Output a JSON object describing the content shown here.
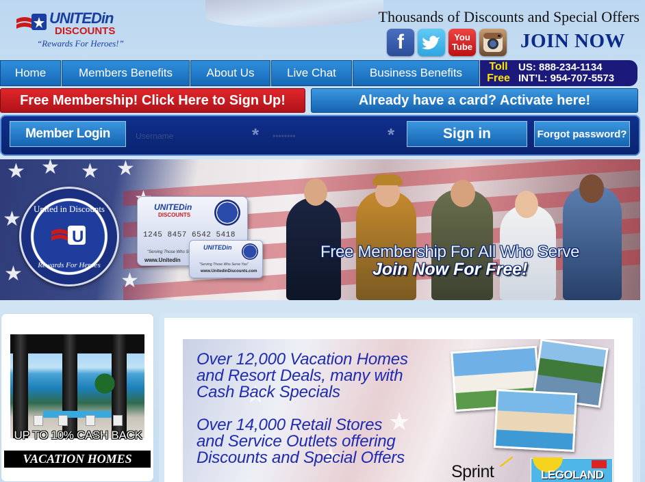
{
  "header": {
    "logo": {
      "name": "UNITEDin",
      "sub": "DISCOUNTS",
      "tagline": "“Rewards For Heroes!”"
    },
    "tagline": "Thousands of Discounts and Special Offers",
    "social": [
      {
        "name": "facebook",
        "icon": "f"
      },
      {
        "name": "twitter",
        "icon": "t"
      },
      {
        "name": "youtube",
        "icon_top": "You",
        "icon_bottom": "Tube"
      },
      {
        "name": "instagram",
        "icon": "camera"
      }
    ],
    "join_now": "JOIN NOW"
  },
  "nav": {
    "items": [
      {
        "label": "Home"
      },
      {
        "label": "Members Benefits"
      },
      {
        "label": "About Us"
      },
      {
        "label": "Live Chat"
      },
      {
        "label": "Business Benefits"
      }
    ],
    "toll": {
      "label_line1": "Toll",
      "label_line2": "Free",
      "us": "US: 888-234-1134",
      "intl": "INT’L: 954-707-5573"
    }
  },
  "signup": {
    "free_label": "Free Membership! Click Here to Sign Up!",
    "activate_label": "Already have a card? Activate here!"
  },
  "login": {
    "member_login": "Member Login",
    "username_placeholder": "Username",
    "password_placeholder": "••••••••",
    "required_mark": "*",
    "sign_in": "Sign in",
    "forgot": "Forgot password?"
  },
  "banner": {
    "seal_top": "United in Discounts",
    "seal_bottom": "Rewards For Heroes",
    "card_brand": "UNITEDin",
    "card_brand_sub": "DISCOUNTS",
    "card_number": "1245  8457  6542  5418",
    "card_serving": "\"Serving Those Who Serve You\"",
    "card_site": "www.Unitedin",
    "card2_brand": "UNITEDin",
    "card2_serving": "\"Serving Those Who Serve You\"",
    "card2_site": "www.UnitedinDiscounts.com",
    "headline": "Free Membership For All Who Serve",
    "subheadline": "Join Now For Free!"
  },
  "promo": {
    "cashback": "UP TO 10% CASH BACK",
    "label": "VACATION HOMES"
  },
  "deals": {
    "line1": "Over 12,000 Vacation Homes",
    "line2": "and Resort Deals, many with",
    "line3": "Cash Back Specials",
    "line4": "Over 14,000 Retail Stores",
    "line5": "and Service Outlets offering",
    "line6": "Discounts and Special Offers",
    "sprint": "Sprint",
    "legoland": "LEGOLAND"
  },
  "colors": {
    "nav_blue": "#1f7cc8",
    "signup_red": "#d01c22",
    "login_bar": "#0f2f8c",
    "deal_text": "#1e2ab0",
    "join_now": "#0c2a8a"
  }
}
